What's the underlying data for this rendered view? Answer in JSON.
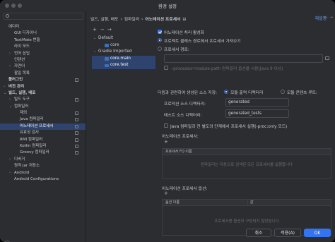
{
  "window": {
    "title": "환경 설정"
  },
  "sidebar": {
    "items": [
      {
        "label": "에디터",
        "indent": 0,
        "chevron": ""
      },
      {
        "label": "GUI 디자이너",
        "indent": 1,
        "chevron": ""
      },
      {
        "label": "TextMate 번들",
        "indent": 1,
        "chevron": ""
      },
      {
        "label": "라이 모드",
        "indent": 1,
        "chevron": ""
      },
      {
        "label": "언어 삽입",
        "indent": 1,
        "chevron": "›"
      },
      {
        "label": "인텐션",
        "indent": 1,
        "chevron": ""
      },
      {
        "label": "자연어",
        "indent": 1,
        "chevron": "›"
      },
      {
        "label": "할일 목록",
        "indent": 1,
        "chevron": ""
      },
      {
        "label": "플러그인",
        "indent": 0,
        "chevron": "",
        "bold": true
      },
      {
        "label": "버전 관리",
        "indent": 0,
        "chevron": "›",
        "bold": true
      },
      {
        "label": "빌드, 실행, 배포",
        "indent": 0,
        "chevron": "⌄",
        "bold": true
      },
      {
        "label": "빌드 도구",
        "indent": 1,
        "chevron": "›"
      },
      {
        "label": "컴파일러",
        "indent": 1,
        "chevron": "⌄"
      },
      {
        "label": "제외",
        "indent": 2,
        "chevron": ""
      },
      {
        "label": "Java 컴파일러",
        "indent": 2,
        "chevron": ""
      },
      {
        "label": "어노테이션 프로세서",
        "indent": 2,
        "chevron": "",
        "selected": true
      },
      {
        "label": "유효성 검사",
        "indent": 2,
        "chevron": ""
      },
      {
        "label": "RMI 컴파일러",
        "indent": 2,
        "chevron": ""
      },
      {
        "label": "Kotlin 컴파일러",
        "indent": 2,
        "chevron": ""
      },
      {
        "label": "Groovy 컴파일러",
        "indent": 2,
        "chevron": ""
      },
      {
        "label": "디버거",
        "indent": 1,
        "chevron": "›"
      },
      {
        "label": "원격 Jar 저장소",
        "indent": 1,
        "chevron": ""
      },
      {
        "label": "Android",
        "indent": 1,
        "chevron": "›"
      },
      {
        "label": "Android Configurations",
        "indent": 1,
        "chevron": ""
      }
    ],
    "help_label": "?"
  },
  "header": {
    "breadcrumbs": [
      "빌드, 실행, 배포",
      "›",
      "컴파일러",
      "›",
      "어노테이션 프로세서",
      "⊟"
    ],
    "reset_label": "재설정",
    "back_glyph": "←",
    "forward_glyph": "→"
  },
  "profiles": {
    "add_glyph": "+",
    "remove_glyph": "−",
    "move_glyph": "→",
    "items": [
      {
        "label": "Default",
        "indent": 0,
        "chevron": "⌄"
      },
      {
        "label": "core",
        "indent": 1,
        "chevron": ""
      },
      {
        "label": "Gradle Imported",
        "indent": 0,
        "chevron": "⌄"
      },
      {
        "label": "core.main",
        "indent": 1,
        "chevron": "",
        "selected": true
      },
      {
        "label": "core.test",
        "indent": 1,
        "chevron": "",
        "selected": true
      }
    ]
  },
  "options": {
    "enable_processing": "어노테이션 처리 활성화",
    "obtain_from_classpath": "프로젝트 클래스 경로에서 프로세서 가져오기",
    "processor_path": "프로세서 경로:",
    "module_path_placeholder": "--processor-module-path 컴파일러 옵션을 사용(Java 9 이상)",
    "store_label": "다음과 관련하여 생성된 소스 저장:",
    "module_output_dir": "모듈 출력 디렉터리",
    "module_content_root": "모듈 콘텐츠 루트:",
    "prod_dir_label": "프로덕션 소스 디렉터리:",
    "prod_dir_value": "generated",
    "test_dir_label": "테스트 소스 디렉터리:",
    "test_dir_value": "generated_tests",
    "run_before_compile": "Java 컴파일과 전 별도의 단계에서 프로세서 실행(-proc:only 모드)",
    "processors_title": "어노테이션 프로세서:",
    "processors_col": "프로세서 FQ 이름",
    "processors_empty": "컴파일러는 자동으로 검색된 모든 프로세서를 실행합니다",
    "proc_options_title": "어노테이션 프로세서 옵션:",
    "opt_col_name": "옵션 이름",
    "opt_col_value": "값",
    "options_empty": "프로세서용 옵션이 구성되지 않았습니다"
  },
  "footer": {
    "cancel": "취소",
    "apply": "적용(A)",
    "ok": "OK"
  }
}
